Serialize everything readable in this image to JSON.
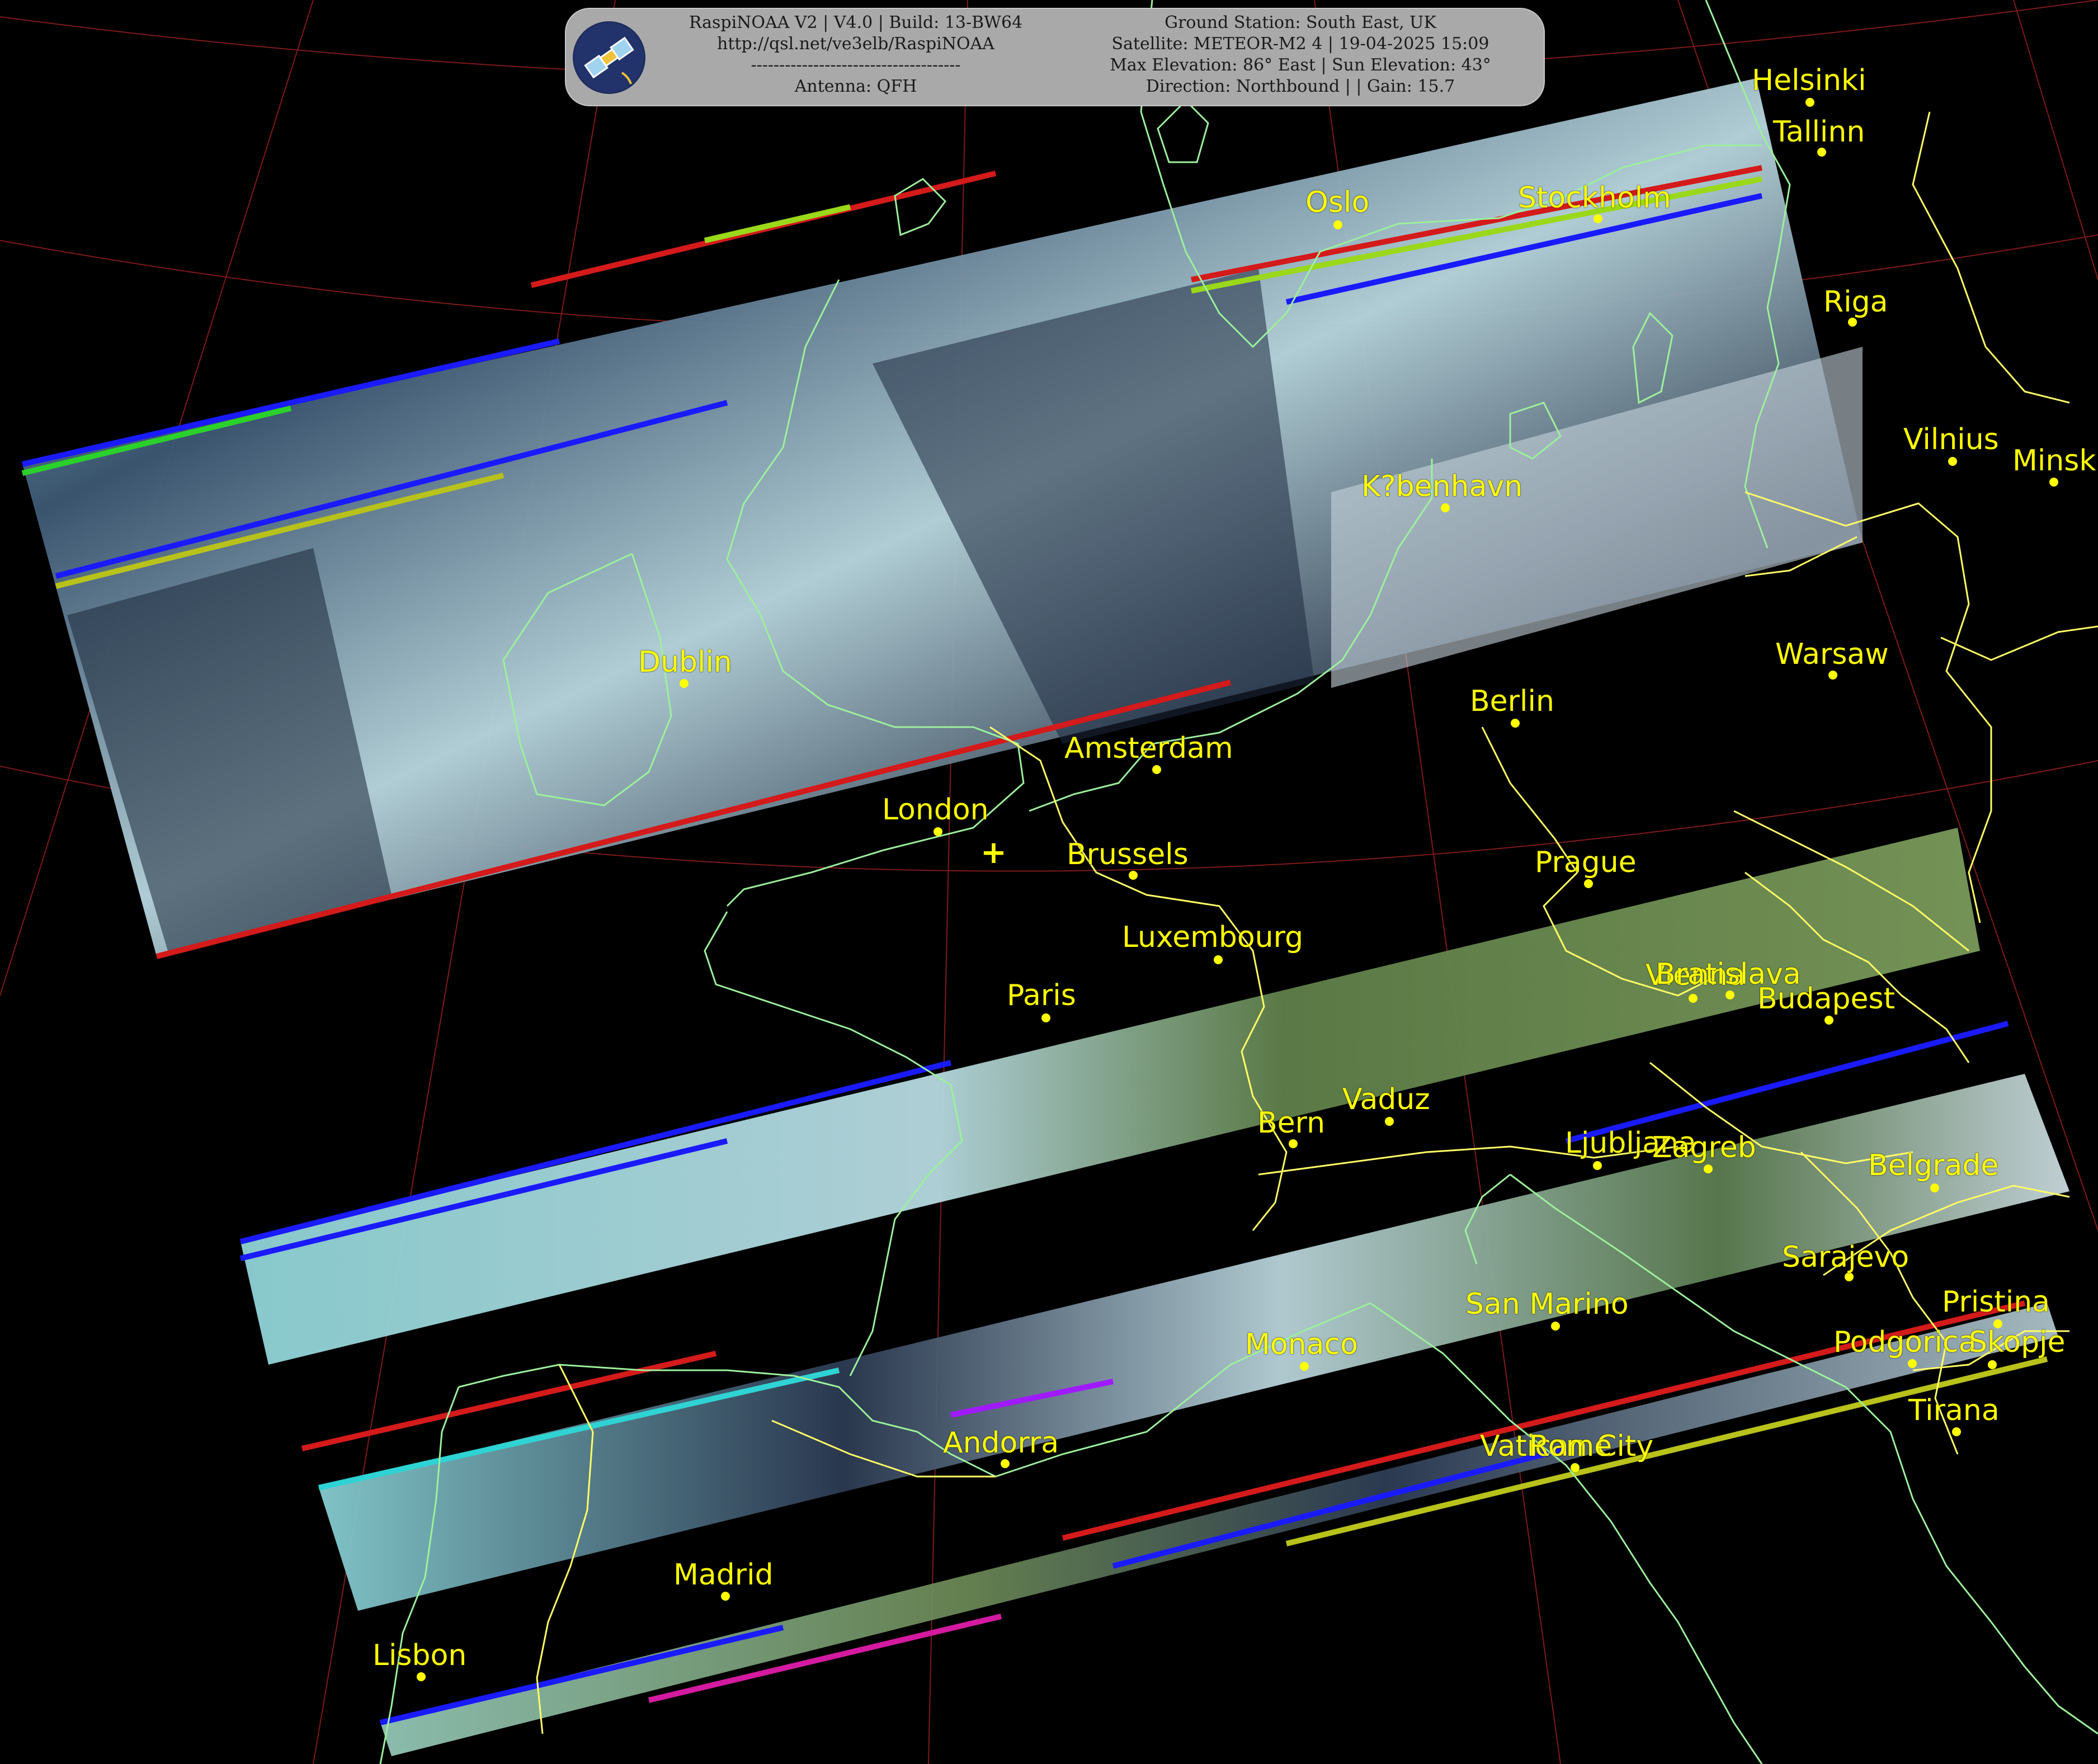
{
  "header": {
    "left_lines": [
      "RaspiNOAA V2 | V4.0 | Build: 13-BW64",
      "http://qsl.net/ve3elb/RaspiNOAA",
      "-------------------------------------",
      "Antenna: QFH"
    ],
    "right_lines": [
      "Ground Station: South East, UK",
      "Satellite: METEOR-M2 4 | 19-04-2025 15:09",
      "Max Elevation: 86° East | Sun Elevation: 43°",
      "Direction: Northbound | | Gain: 15.7"
    ],
    "logo_icon": "satellite-icon"
  },
  "cities": [
    {
      "name": "Helsinki"
    },
    {
      "name": "Tallinn"
    },
    {
      "name": "Oslo"
    },
    {
      "name": "Stockholm"
    },
    {
      "name": "Riga"
    },
    {
      "name": "Vilnius"
    },
    {
      "name": "Minsk"
    },
    {
      "name": "K?benhavn"
    },
    {
      "name": "Warsaw"
    },
    {
      "name": "Dublin"
    },
    {
      "name": "Berlin"
    },
    {
      "name": "Amsterdam"
    },
    {
      "name": "London"
    },
    {
      "name": "Brussels"
    },
    {
      "name": "Prague"
    },
    {
      "name": "Luxembourg"
    },
    {
      "name": "Vienna"
    },
    {
      "name": "Bratislava"
    },
    {
      "name": "Budapest"
    },
    {
      "name": "Paris"
    },
    {
      "name": "Vaduz"
    },
    {
      "name": "Bern"
    },
    {
      "name": "Ljubljana"
    },
    {
      "name": "Zagreb"
    },
    {
      "name": "Belgrade"
    },
    {
      "name": "Sarajevo"
    },
    {
      "name": "San Marino"
    },
    {
      "name": "Pristina"
    },
    {
      "name": "Monaco"
    },
    {
      "name": "Podgorica"
    },
    {
      "name": "Skopje"
    },
    {
      "name": "Andorra"
    },
    {
      "name": "Tirana"
    },
    {
      "name": "Vatican City"
    },
    {
      "name": "Rome"
    },
    {
      "name": "Madrid"
    },
    {
      "name": "Lisbon"
    }
  ],
  "colors": {
    "label": "#ffff00",
    "coastline": "#9cf09c",
    "border": "#ffff66",
    "graticule": "#a02020",
    "header_bg": "#a9a9a9"
  }
}
